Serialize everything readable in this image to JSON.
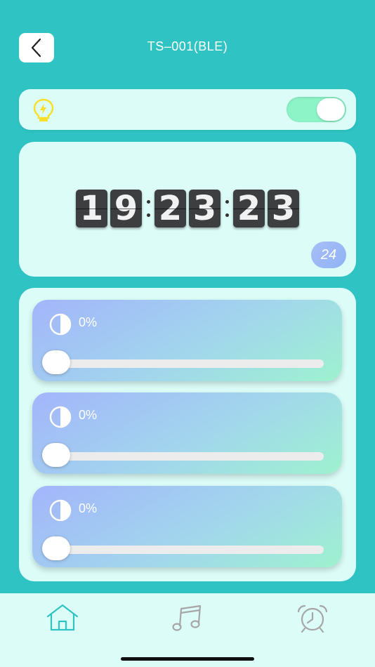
{
  "header": {
    "title": "TS–001(BLE)",
    "back_icon": "chevron-left-icon"
  },
  "light": {
    "icon": "lightbulb-icon",
    "toggle_on": true,
    "colors": {
      "bulb": "#f7df2a",
      "toggle_on": "#8cf4c6"
    }
  },
  "clock": {
    "hours": [
      "1",
      "9"
    ],
    "minutes": [
      "2",
      "3"
    ],
    "seconds": [
      "2",
      "3"
    ],
    "format_badge": "24"
  },
  "sliders": [
    {
      "icon": "half-circle-icon",
      "value_label": "0%",
      "value": 0
    },
    {
      "icon": "half-circle-icon",
      "value_label": "0%",
      "value": 0
    },
    {
      "icon": "half-circle-icon",
      "value_label": "0%",
      "value": 0
    }
  ],
  "tabbar": {
    "tabs": [
      {
        "name": "home",
        "icon": "home-icon",
        "active": true
      },
      {
        "name": "music",
        "icon": "music-note-icon",
        "active": false
      },
      {
        "name": "alarm",
        "icon": "alarm-clock-icon",
        "active": false
      }
    ],
    "colors": {
      "active": "#2fc3c3",
      "inactive": "#a6a6a6"
    }
  },
  "theme": {
    "background": "#2fc3c3",
    "card": "#dcfcf8"
  }
}
